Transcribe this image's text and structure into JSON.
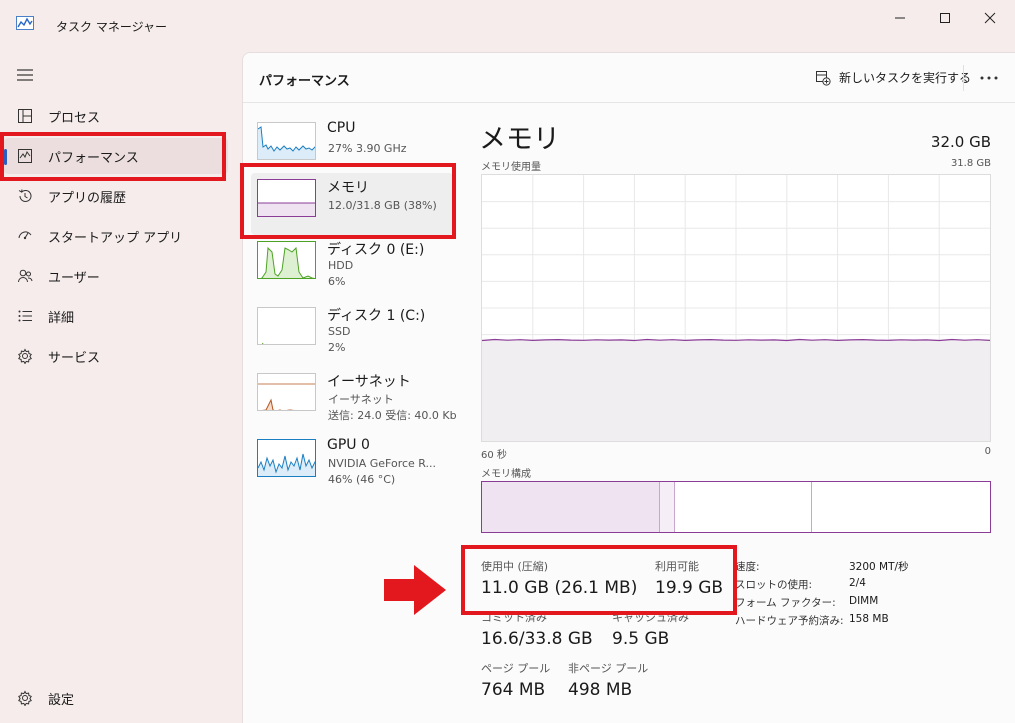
{
  "window": {
    "title": "タスク マネージャー"
  },
  "sidebar": {
    "items": [
      {
        "label": "プロセス",
        "icon": "processes-icon"
      },
      {
        "label": "パフォーマンス",
        "icon": "performance-icon",
        "active": true
      },
      {
        "label": "アプリの履歴",
        "icon": "history-icon"
      },
      {
        "label": "スタートアップ アプリ",
        "icon": "startup-icon"
      },
      {
        "label": "ユーザー",
        "icon": "users-icon"
      },
      {
        "label": "詳細",
        "icon": "details-icon"
      },
      {
        "label": "サービス",
        "icon": "services-icon"
      }
    ],
    "settings_label": "設定"
  },
  "header": {
    "title": "パフォーマンス",
    "new_task_label": "新しいタスクを実行する",
    "more_label": "…"
  },
  "resources": [
    {
      "name": "CPU",
      "sub1": "27%  3.90 GHz"
    },
    {
      "name": "メモリ",
      "sub1": "12.0/31.8 GB (38%)"
    },
    {
      "name": "ディスク 0 (E:)",
      "sub1": "HDD",
      "sub2": "6%"
    },
    {
      "name": "ディスク 1 (C:)",
      "sub1": "SSD",
      "sub2": "2%"
    },
    {
      "name": "イーサネット",
      "sub1": "イーサネット",
      "sub2": "送信: 24.0  受信: 40.0 Kb"
    },
    {
      "name": "GPU 0",
      "sub1": "NVIDIA GeForce R...",
      "sub2": "46% (46 °C)"
    }
  ],
  "detail": {
    "title": "メモリ",
    "total": "32.0 GB",
    "usage_label": "メモリ使用量",
    "usage_max": "31.8 GB",
    "axis_left": "60 秒",
    "axis_right": "0",
    "composition_label": "メモリ構成",
    "usage_fraction": 0.38,
    "stats": {
      "in_use_label": "使用中 (圧縮)",
      "in_use_value": "11.0 GB (26.1 MB)",
      "available_label": "利用可能",
      "available_value": "19.9 GB",
      "committed_label": "コミット済み",
      "committed_value": "16.6/33.8 GB",
      "cached_label": "キャッシュ済み",
      "cached_value": "9.5 GB",
      "paged_label": "ページ プール",
      "paged_value": "764 MB",
      "nonpaged_label": "非ページ プール",
      "nonpaged_value": "498 MB"
    },
    "specs": [
      {
        "label": "速度:",
        "value": "3200 MT/秒"
      },
      {
        "label": "スロットの使用:",
        "value": "2/4"
      },
      {
        "label": "フォーム ファクター:",
        "value": "DIMM"
      },
      {
        "label": "ハードウェア予約済み:",
        "value": "158 MB"
      }
    ]
  },
  "colors": {
    "memory_accent": "#8a3c96",
    "cpu_accent": "#1a7fc1",
    "disk_accent": "#4da225",
    "ethernet_accent": "#b5551e",
    "highlight": "#e3181f"
  }
}
